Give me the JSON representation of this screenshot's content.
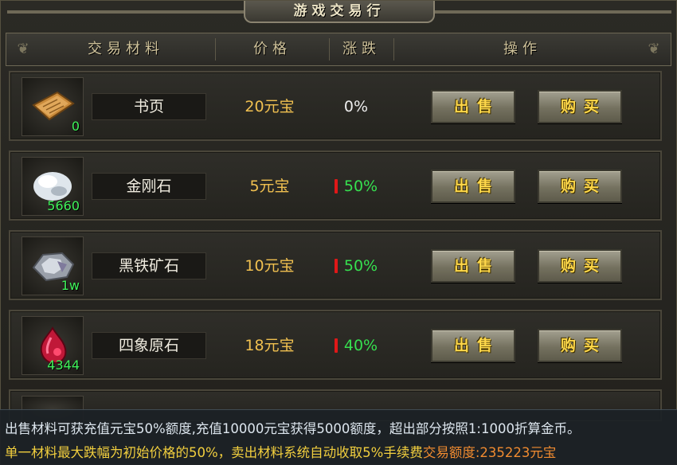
{
  "window": {
    "title": "游戏交易行"
  },
  "header": {
    "col_material": "交易材料",
    "col_price": "价格",
    "col_change": "涨跌",
    "col_actions": "操作"
  },
  "rows": [
    {
      "name": "书页",
      "count": "0",
      "price": "20元宝",
      "change": "0%",
      "trend": "flat",
      "icon": "book-page-icon",
      "sell_label": "出售",
      "buy_label": "购买"
    },
    {
      "name": "金刚石",
      "count": "5660",
      "price": "5元宝",
      "change": "50%",
      "trend": "down",
      "icon": "diamond-stone-icon",
      "sell_label": "出售",
      "buy_label": "购买"
    },
    {
      "name": "黑铁矿石",
      "count": "1w",
      "price": "10元宝",
      "change": "50%",
      "trend": "down",
      "icon": "black-iron-ore-icon",
      "sell_label": "出售",
      "buy_label": "购买"
    },
    {
      "name": "四象原石",
      "count": "4344",
      "price": "18元宝",
      "change": "40%",
      "trend": "down",
      "icon": "four-symbol-stone-icon",
      "sell_label": "出售",
      "buy_label": "购买"
    }
  ],
  "footer": {
    "line1": "出售材料可获充值元宝50%额度,充值10000元宝获得5000额度，超出部分按照1:1000折算金币。",
    "line2": "单一材料最大跌幅为初始价格的50%，卖出材料系统自动收取5%手续费",
    "quota_label": "交易额度:",
    "quota_value": "235223元宝"
  },
  "colors": {
    "price": "#f0c050",
    "down": "#36e04f",
    "down_marker": "#e01818",
    "count": "#3ff25a",
    "button_text": "#ffd84a",
    "quota": "#f08b30"
  }
}
